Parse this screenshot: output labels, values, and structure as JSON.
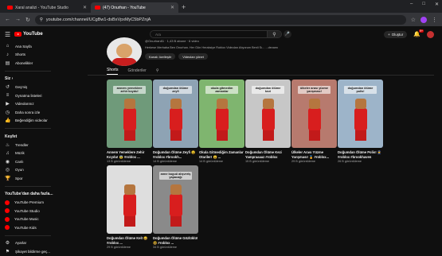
{
  "browser": {
    "tabs": [
      {
        "title": "Xaral analizi - YouTube Studio",
        "active": false
      },
      {
        "title": "(47) Onurhan - YouTube",
        "active": true
      }
    ],
    "url": "youtube.com/channel/UCgBw1-dsBxVpxMyC5bPZnjA",
    "window_controls": [
      "–",
      "□",
      "✕"
    ]
  },
  "youtube": {
    "logo": "YouTube",
    "search_placeholder": "Ara",
    "create_label": "Oluştur",
    "notification_count": "9+"
  },
  "sidebar": {
    "main": [
      {
        "icon": "home-icon",
        "glyph": "⌂",
        "label": "Ana Sayfa"
      },
      {
        "icon": "shorts-icon",
        "glyph": "♪",
        "label": "Shorts"
      },
      {
        "icon": "subscriptions-icon",
        "glyph": "▤",
        "label": "Abonelikler"
      }
    ],
    "you_heading": "Siz ›",
    "you": [
      {
        "icon": "history-icon",
        "glyph": "↺",
        "label": "Geçmiş"
      },
      {
        "icon": "playlists-icon",
        "glyph": "≡",
        "label": "Oynatma listeleri"
      },
      {
        "icon": "videos-icon",
        "glyph": "▶",
        "label": "Videolarınız"
      },
      {
        "icon": "watch-later-icon",
        "glyph": "◷",
        "label": "Daha sonra izle"
      },
      {
        "icon": "liked-icon",
        "glyph": "👍",
        "label": "Beğendiğim videolar"
      }
    ],
    "explore_heading": "Keşfet",
    "explore": [
      {
        "icon": "trending-icon",
        "glyph": "♨",
        "label": "Trendler"
      },
      {
        "icon": "music-icon",
        "glyph": "♫",
        "label": "Müzik"
      },
      {
        "icon": "live-icon",
        "glyph": "◉",
        "label": "Canlı"
      },
      {
        "icon": "gaming-icon",
        "glyph": "◎",
        "label": "Oyun"
      },
      {
        "icon": "sports-icon",
        "glyph": "🏆",
        "label": "Spor"
      }
    ],
    "more_heading": "YouTube'dan daha fazla...",
    "more": [
      {
        "icon": "premium-icon",
        "label": "YouTube Premium"
      },
      {
        "icon": "studio-icon",
        "label": "YouTube Studio"
      },
      {
        "icon": "yt-music-icon",
        "label": "YouTube Music"
      },
      {
        "icon": "yt-kids-icon",
        "label": "YouTube Kids"
      }
    ],
    "settings": [
      {
        "icon": "settings-icon",
        "glyph": "⚙",
        "label": "Ayarlar"
      },
      {
        "icon": "report-icon",
        "glyph": "⚑",
        "label": "Şikayet bildirme geç..."
      }
    ]
  },
  "channel": {
    "meta": "@Onurhan81 · 1,43 B abone · 6 video",
    "description": "Herkese Merhaba Ben Onurhan. Her Gün Heraksiye Roblox Videoları Atıyorum Benli Sı... ...devamı",
    "buttons": [
      "Kanalı özelleştir",
      "Videoları yönet"
    ],
    "tabs": [
      "Shorts",
      "Gönderiler"
    ]
  },
  "shorts": [
    {
      "caption": "annem yemeklere zehir koydu!",
      "title": "Annem Yemeklere Zehir Koydu! 😨 #roblox ...",
      "views": "13 B görüntüleme",
      "bg": "#6f9a7a"
    },
    {
      "caption": "doğumdan ölüme zeyfi",
      "title": "Doğumdan Ölüme Zeyfi 😮 #roblox #brookh...",
      "views": "14 B görüntüleme",
      "bg": "#8ea3b4"
    },
    {
      "caption": "okula gitmedim zamanlar",
      "title": "Okula Gitmediğim Zamanlar Otariler! 😩 ...",
      "views": "14 B görüntüleme",
      "bg": "#7fb56f"
    },
    {
      "caption": "doğumdan ölüme kezi",
      "title": "Doğumdan Ölüme Kezi Yampraaaaz #roblox #brookhaven",
      "views": "15 B görüntüleme",
      "bg": "#c7c7c7"
    },
    {
      "caption": "ülkeler arası yüzme yarışması!",
      "title": "Ülkeler Arası Yüzme Yarışması! 🏅 #roblox...",
      "views": "29 B görüntüleme",
      "bg": "#b77a6e"
    },
    {
      "caption": "doğumdan ölüme polis!",
      "title": "Doğumdan Ölüme Polis! 👮 #roblox #brookhaven",
      "views": "26 B görüntüleme",
      "bg": "#9db4c9"
    },
    {
      "caption": "",
      "title": "Doğumdan Ölüme Kel! 😄 #roblox ...",
      "views": "29 B görüntüleme",
      "bg": "#dedede"
    },
    {
      "caption": "anne buguü alışveriş yapacağı",
      "title": "Doğumdan Ölüme Gözlüklü! 🤓 #roblox ...",
      "views": "34 B görüntüleme",
      "bg": "#8a8a8a"
    }
  ]
}
